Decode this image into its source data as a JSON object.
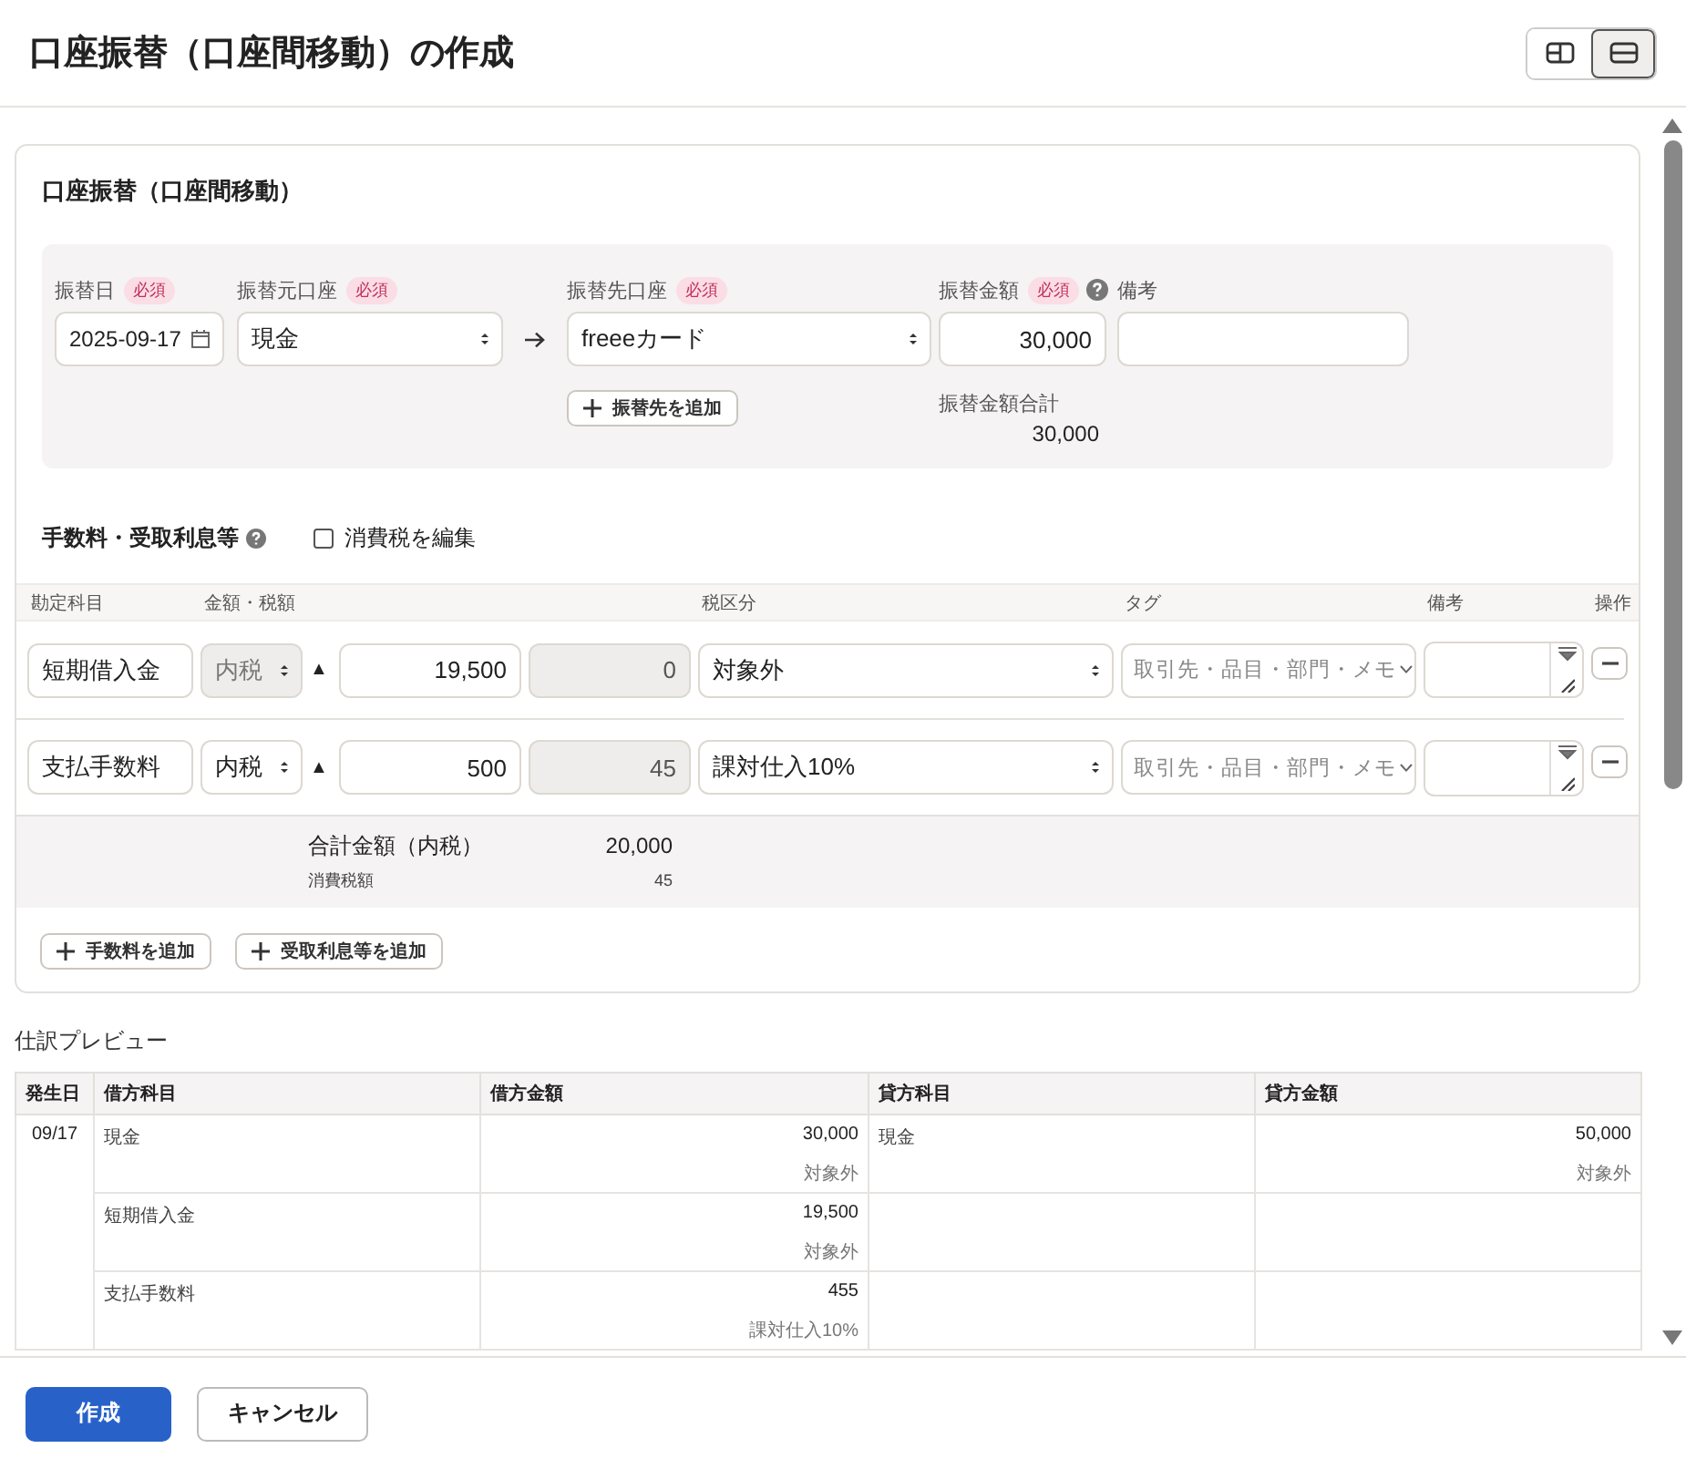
{
  "header": {
    "title": "口座振替（口座間移動）の作成",
    "view_toggle": [
      {
        "kind": "split",
        "selected": false
      },
      {
        "kind": "stacked",
        "selected": true
      }
    ]
  },
  "transfer": {
    "title": "口座振替（口座間移動）",
    "date": {
      "label": "振替日",
      "badge": "必須",
      "value": "2025-09-17"
    },
    "from": {
      "label": "振替元口座",
      "badge": "必須",
      "value": "現金"
    },
    "to": {
      "label": "振替先口座",
      "badge": "必須",
      "value": "freeeカード"
    },
    "add_destination": "振替先を追加",
    "amount": {
      "label": "振替金額",
      "badge": "必須",
      "value": "30,000"
    },
    "memo": {
      "label": "備考"
    },
    "total_label": "振替金額合計",
    "total": "30,000"
  },
  "fees": {
    "title": "手数料・受取利息等",
    "edit_tax": {
      "label": "消費税を編集",
      "checked": false
    },
    "columns": [
      "勘定科目",
      "金額・税額",
      "税区分",
      "タグ",
      "備考",
      "操作"
    ],
    "rows": [
      {
        "account": "短期借入金",
        "tax_mode": "内税",
        "tax_mode_disabled": true,
        "sign": "▲",
        "amount": "19,500",
        "tax": "0",
        "tax_class": "対象外",
        "tag_placeholder": "取引先・品目・部門・メモ"
      },
      {
        "account": "支払手数料",
        "tax_mode": "内税",
        "tax_mode_disabled": false,
        "sign": "▲",
        "amount": "500",
        "tax": "45",
        "tax_class": "課対仕入10%",
        "tag_placeholder": "取引先・品目・部門・メモ"
      }
    ],
    "total_label": "合計金額（内税）",
    "total": "20,000",
    "tax_label": "消費税額",
    "tax_total": "45",
    "add_buttons": [
      "手数料を追加",
      "受取利息等を追加"
    ]
  },
  "preview": {
    "title": "仕訳プレビュー",
    "columns": [
      "発生日",
      "借方科目",
      "借方金額",
      "貸方科目",
      "貸方金額"
    ],
    "date": "09/17",
    "rows": [
      {
        "debit_account": "現金",
        "debit_amount": "30,000",
        "debit_tax": "対象外",
        "credit_account": "現金",
        "credit_amount": "50,000",
        "credit_tax": "対象外"
      },
      {
        "debit_account": "短期借入金",
        "debit_amount": "19,500",
        "debit_tax": "対象外"
      },
      {
        "debit_account": "支払手数料",
        "debit_amount": "455",
        "debit_tax": "課対仕入10%"
      }
    ]
  },
  "footer": {
    "buttons": [
      {
        "label": "作成",
        "kind": "primary"
      },
      {
        "label": "キャンセル",
        "kind": "secondary"
      }
    ]
  }
}
